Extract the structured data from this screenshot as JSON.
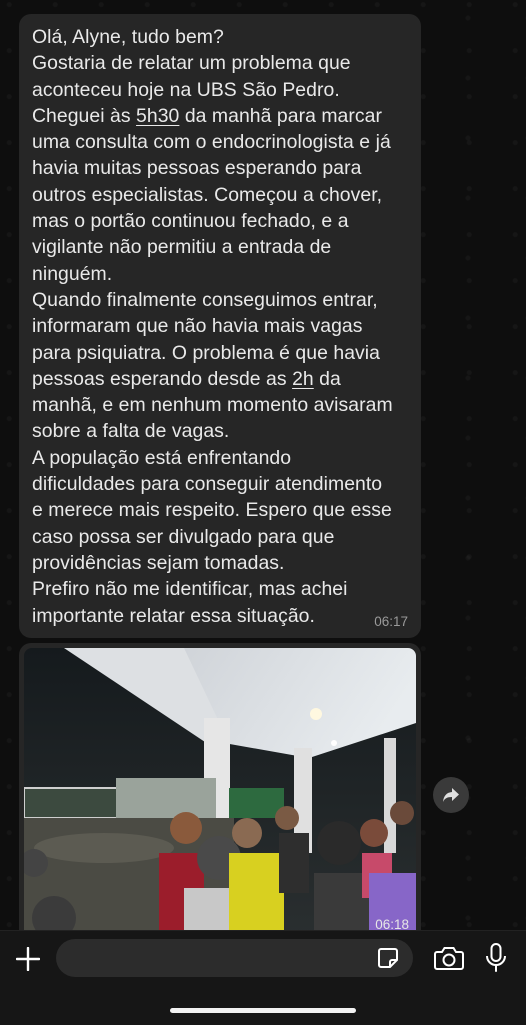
{
  "message1": {
    "lines": [
      "Olá, Alyne, tudo bem?",
      "Gostaria de relatar um problema que",
      "aconteceu hoje na UBS São Pedro.",
      "Cheguei às ",
      "5h30",
      " da manhã para marcar",
      "uma consulta com o endocrinologista e já",
      "havia muitas pessoas esperando para",
      "outros especialistas. Começou a chover,",
      "mas o portão continuou fechado, e a",
      "vigilante não permitiu a entrada de",
      "ninguém.",
      "Quando finalmente conseguimos entrar,",
      "informaram que não havia mais vagas",
      "para psiquiatra. O problema é que havia",
      "pessoas esperando desde as ",
      "2h",
      " da",
      "manhã, e em nenhum momento avisaram",
      "sobre a falta de vagas.",
      "A população está enfrentando",
      "dificuldades para conseguir atendimento",
      "e merece mais respeito. Espero que esse",
      "caso possa ser divulgado para que",
      "providências sejam tomadas.",
      "Prefiro não me identificar, mas achei",
      "importante relatar essa situação."
    ],
    "time": "06:17"
  },
  "message2": {
    "time": "06:18"
  },
  "icons": {
    "share": "share-forward-icon",
    "plus": "plus-icon",
    "sticker": "sticker-icon",
    "camera": "camera-icon",
    "mic": "microphone-icon"
  },
  "colors": {
    "bubble": "#262626",
    "background": "#0e0e0e",
    "text": "#e9e9e9"
  }
}
